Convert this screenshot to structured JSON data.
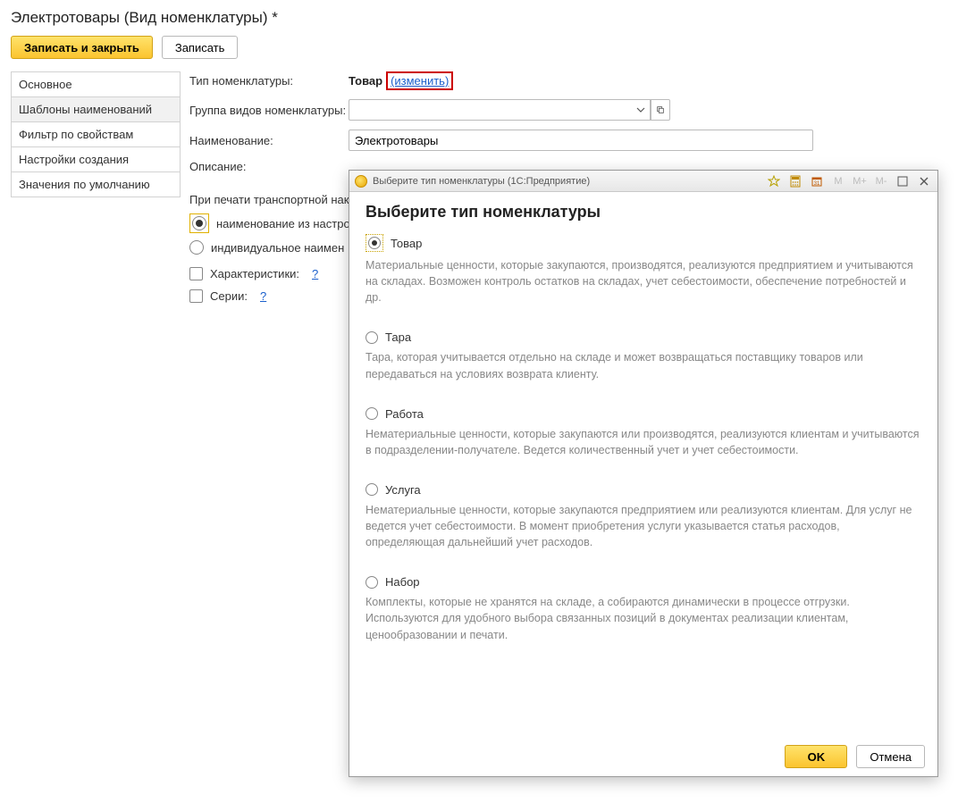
{
  "page": {
    "title": "Электротовары (Вид номенклатуры) *"
  },
  "toolbar": {
    "save_close": "Записать и закрыть",
    "save": "Записать"
  },
  "sidebar": {
    "items": [
      {
        "label": "Основное"
      },
      {
        "label": "Шаблоны наименований"
      },
      {
        "label": "Фильтр по свойствам"
      },
      {
        "label": "Настройки создания"
      },
      {
        "label": "Значения по умолчанию"
      }
    ],
    "active_index": 1
  },
  "form": {
    "type_label": "Тип номенклатуры:",
    "type_value": "Товар",
    "change_link": "(изменить)",
    "group_label": "Группа видов номенклатуры:",
    "group_value": "",
    "name_label": "Наименование:",
    "name_value": "Электротовары",
    "desc_label": "Описание:",
    "transport_section": "При печати транспортной нак",
    "radio1": "наименование из настрое",
    "radio2": "индивидуальное наимен",
    "check_char": "Характеристики:",
    "check_series": "Серии:",
    "help": "?"
  },
  "modal": {
    "titlebar": "Выберите тип номенклатуры  (1С:Предприятие)",
    "tb_m": "M",
    "tb_mplus": "M+",
    "tb_mminus": "M-",
    "heading": "Выберите тип номенклатуры",
    "options": [
      {
        "label": "Товар",
        "desc": "Материальные ценности, которые закупаются, производятся, реализуются предприятием и учитываются на складах. Возможен контроль остатков на складах, учет себестоимости, обеспечение потребностей и др.",
        "selected": true
      },
      {
        "label": "Тара",
        "desc": "Тара, которая учитывается отдельно на складе и может возвращаться поставщику товаров или передаваться на условиях возврата клиенту.",
        "selected": false
      },
      {
        "label": "Работа",
        "desc": "Нематериальные ценности, которые закупаются или производятся, реализуются клиентам и учитываются в подразделении-получателе. Ведется количественный учет и учет себестоимости.",
        "selected": false
      },
      {
        "label": "Услуга",
        "desc": "Нематериальные ценности, которые закупаются предприятием или реализуются клиентам. Для услуг не ведется учет себестоимости. В момент приобретения услуги указывается статья расходов, определяющая дальнейший учет расходов.",
        "selected": false
      },
      {
        "label": "Набор",
        "desc": "Комплекты, которые не хранятся на складе, а собираются динамически в процессе отгрузки. Используются для удобного выбора связанных позиций в документах реализации клиентам, ценообразовании и печати.",
        "selected": false
      }
    ],
    "ok": "OK",
    "cancel": "Отмена"
  }
}
